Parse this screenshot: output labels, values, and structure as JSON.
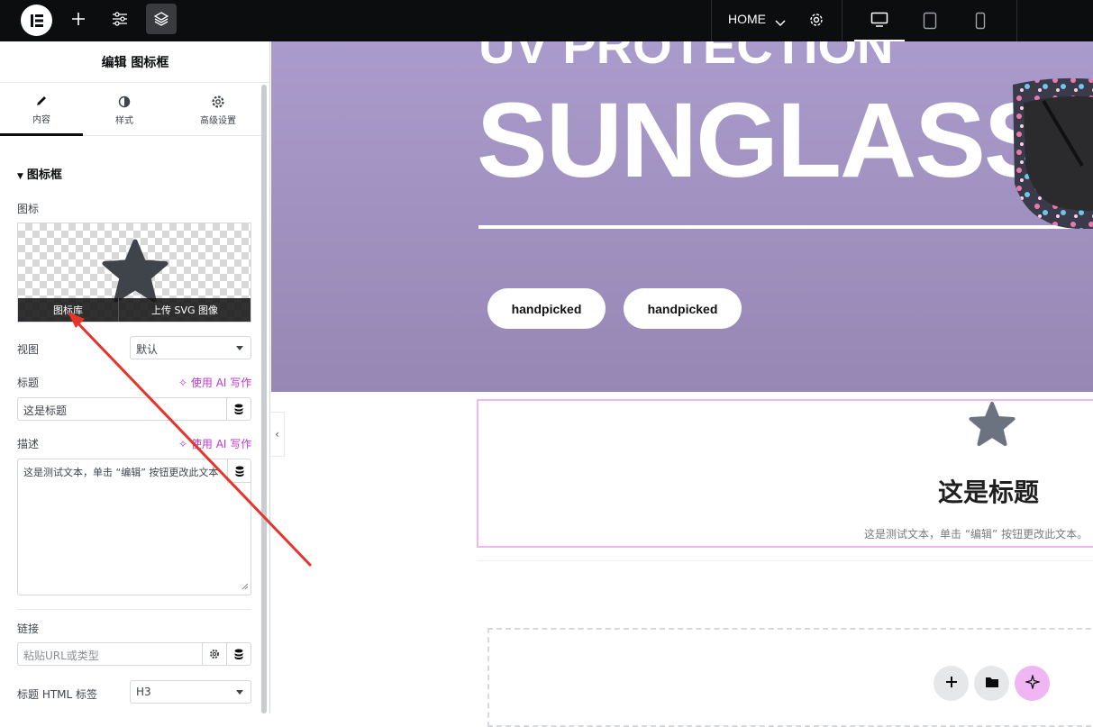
{
  "topbar": {
    "add_icon": "plus-icon",
    "settings_icon": "sliders-icon",
    "structure_icon": "layers-icon",
    "page_name": "HOME",
    "devices": [
      "desktop",
      "tablet",
      "mobile"
    ]
  },
  "panel": {
    "title": "编辑 图标框",
    "tabs": [
      {
        "label": "内容",
        "icon": "pencil-icon"
      },
      {
        "label": "样式",
        "icon": "half-circle-icon"
      },
      {
        "label": "高级设置",
        "icon": "gear-icon"
      }
    ],
    "section_title": "图标框",
    "icon_label": "图标",
    "icon_library_label": "图标库",
    "upload_svg_label": "上传 SVG 图像",
    "view_label": "视图",
    "view_value": "默认",
    "title_label": "标题",
    "ai_write_label": "使用 AI 写作",
    "title_value": "这是标题",
    "description_label": "描述",
    "description_value": "这是测试文本，单击 “编辑” 按钮更改此文本",
    "link_label": "链接",
    "link_placeholder": "粘贴URL或类型",
    "html_tag_label": "标题 HTML 标签",
    "html_tag_value": "H3"
  },
  "canvas": {
    "hero_top_text": "UV PROTECTION",
    "hero_big_text": "SUNGLASSES",
    "buttons": [
      "handpicked",
      "handpicked"
    ],
    "hero_bg": "#a597c6",
    "widget_title": "这是标题",
    "widget_description": "这是测试文本，单击 “编辑” 按钮更改此文本。",
    "bottom_buttons": [
      "plus-icon",
      "folder-icon",
      "ai-sparkle-icon"
    ]
  },
  "colors": {
    "accent": "#c036d0",
    "selection_border": "#f0b6f0",
    "annotation_arrow": "#e8332a"
  }
}
